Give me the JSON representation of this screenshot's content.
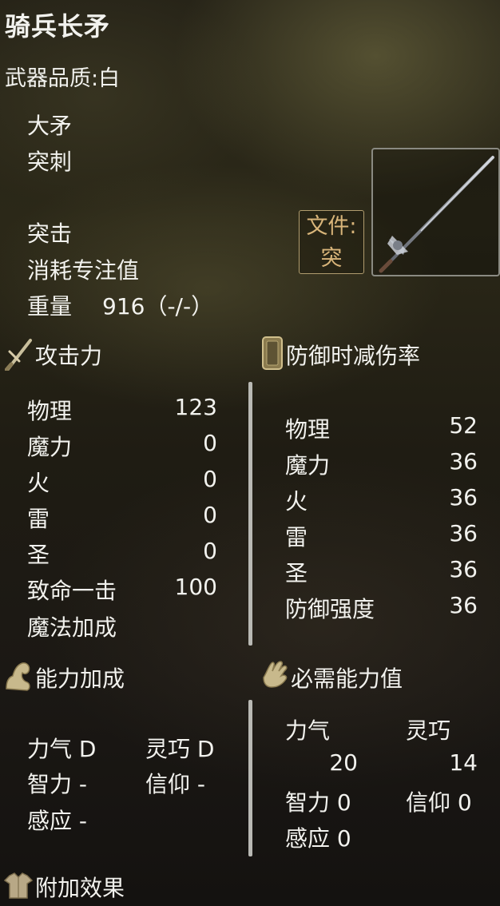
{
  "weapon": {
    "name": "骑兵长矛",
    "quality": "武器品质:白",
    "type": "大矛",
    "attack_type": "突刺",
    "skill": "突击",
    "skill_cost": "消耗专注值",
    "weight_label": "重量",
    "weight_value": "916（-/-）",
    "file_tag_line1": "文件:",
    "file_tag_line2": "突"
  },
  "attack": {
    "title": "攻击力",
    "rows": [
      {
        "label": "物理",
        "value": "123"
      },
      {
        "label": "魔力",
        "value": "0"
      },
      {
        "label": "火",
        "value": "0"
      },
      {
        "label": "雷",
        "value": "0"
      },
      {
        "label": "圣",
        "value": "0"
      },
      {
        "label": "致命一击",
        "value": "100"
      },
      {
        "label": "魔法加成",
        "value": ""
      }
    ]
  },
  "defense": {
    "title": "防御时减伤率",
    "rows": [
      {
        "label": "物理",
        "value": "52"
      },
      {
        "label": "魔力",
        "value": "36"
      },
      {
        "label": "火",
        "value": "36"
      },
      {
        "label": "雷",
        "value": "36"
      },
      {
        "label": "圣",
        "value": "36"
      },
      {
        "label": "防御强度",
        "value": "36"
      }
    ]
  },
  "scaling": {
    "title": "能力加成",
    "str": "力气 D",
    "dex": "灵巧 D",
    "int": "智力  -",
    "fai": "信仰  -",
    "arc": "感应  -"
  },
  "requirements": {
    "title": "必需能力值",
    "str_label": "力气",
    "dex_label": "灵巧",
    "str_value": "20",
    "dex_value": "14",
    "int": "智力 0",
    "fai": "信仰 0",
    "arc": "感应 0"
  },
  "effects": {
    "title": "附加效果"
  },
  "colors": {
    "text": "#f2f2ee",
    "file_tag": "#d9b57a",
    "divider": "#b9b9b4"
  }
}
